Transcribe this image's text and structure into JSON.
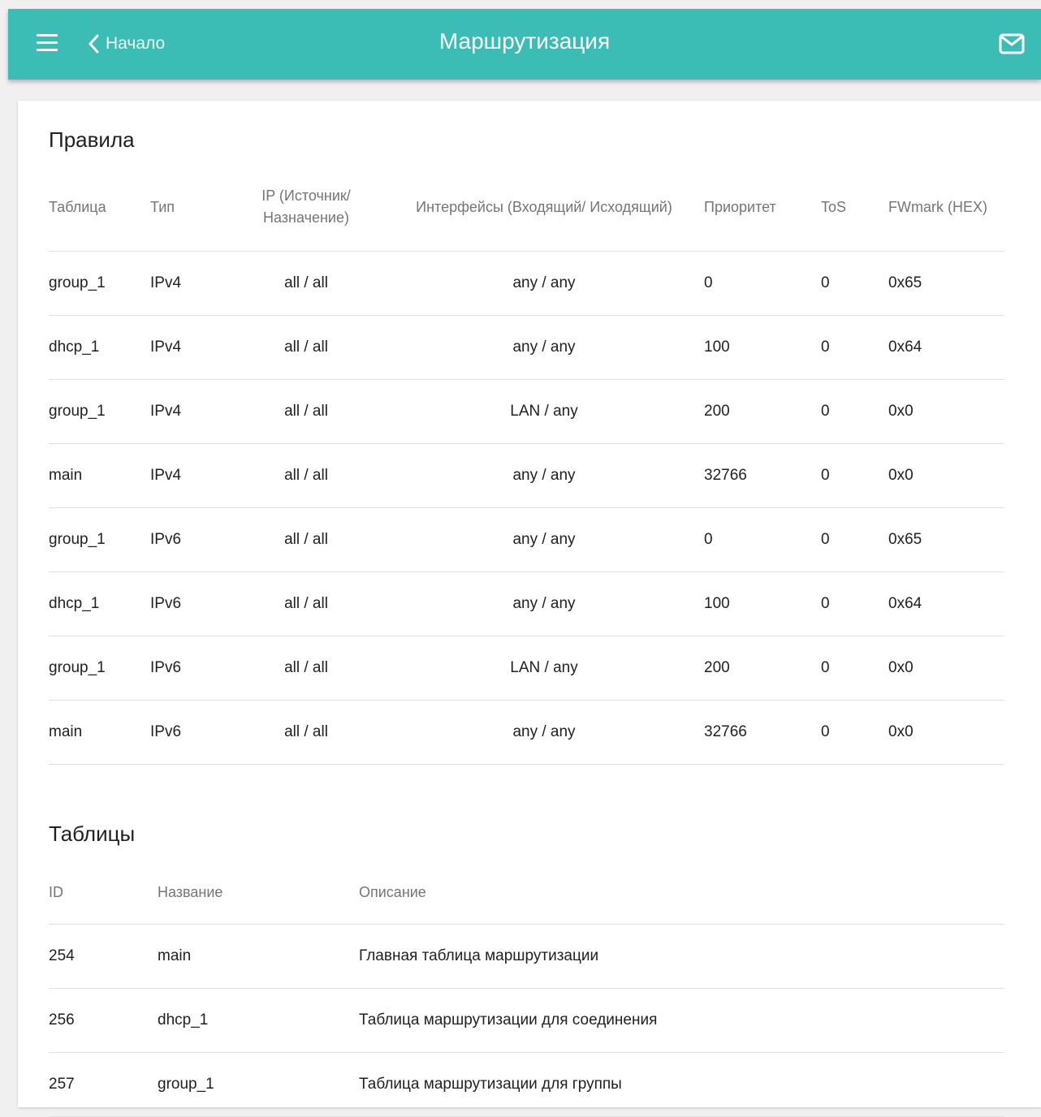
{
  "header": {
    "back_label": "Начало",
    "title": "Маршрутизация",
    "accent_color": "#3bbdb5"
  },
  "rules": {
    "title": "Правила",
    "columns": [
      "Таблица",
      "Тип",
      "IP (Источник/ Назначение)",
      "Интерфейсы (Входящий/ Исходящий)",
      "Приоритет",
      "ToS",
      "FWmark (HEX)"
    ],
    "rows": [
      [
        "group_1",
        "IPv4",
        "all / all",
        "any / any",
        "0",
        "0",
        "0x65"
      ],
      [
        "dhcp_1",
        "IPv4",
        "all / all",
        "any / any",
        "100",
        "0",
        "0x64"
      ],
      [
        "group_1",
        "IPv4",
        "all / all",
        "LAN / any",
        "200",
        "0",
        "0x0"
      ],
      [
        "main",
        "IPv4",
        "all / all",
        "any / any",
        "32766",
        "0",
        "0x0"
      ],
      [
        "group_1",
        "IPv6",
        "all / all",
        "any / any",
        "0",
        "0",
        "0x65"
      ],
      [
        "dhcp_1",
        "IPv6",
        "all / all",
        "any / any",
        "100",
        "0",
        "0x64"
      ],
      [
        "group_1",
        "IPv6",
        "all / all",
        "LAN / any",
        "200",
        "0",
        "0x0"
      ],
      [
        "main",
        "IPv6",
        "all / all",
        "any / any",
        "32766",
        "0",
        "0x0"
      ]
    ]
  },
  "tables": {
    "title": "Таблицы",
    "columns": [
      "ID",
      "Название",
      "Описание"
    ],
    "rows": [
      [
        "254",
        "main",
        "Главная таблица маршрутизации"
      ],
      [
        "256",
        "dhcp_1",
        "Таблица маршрутизации для соединения"
      ],
      [
        "257",
        "group_1",
        "Таблица маршрутизации для группы"
      ]
    ]
  }
}
